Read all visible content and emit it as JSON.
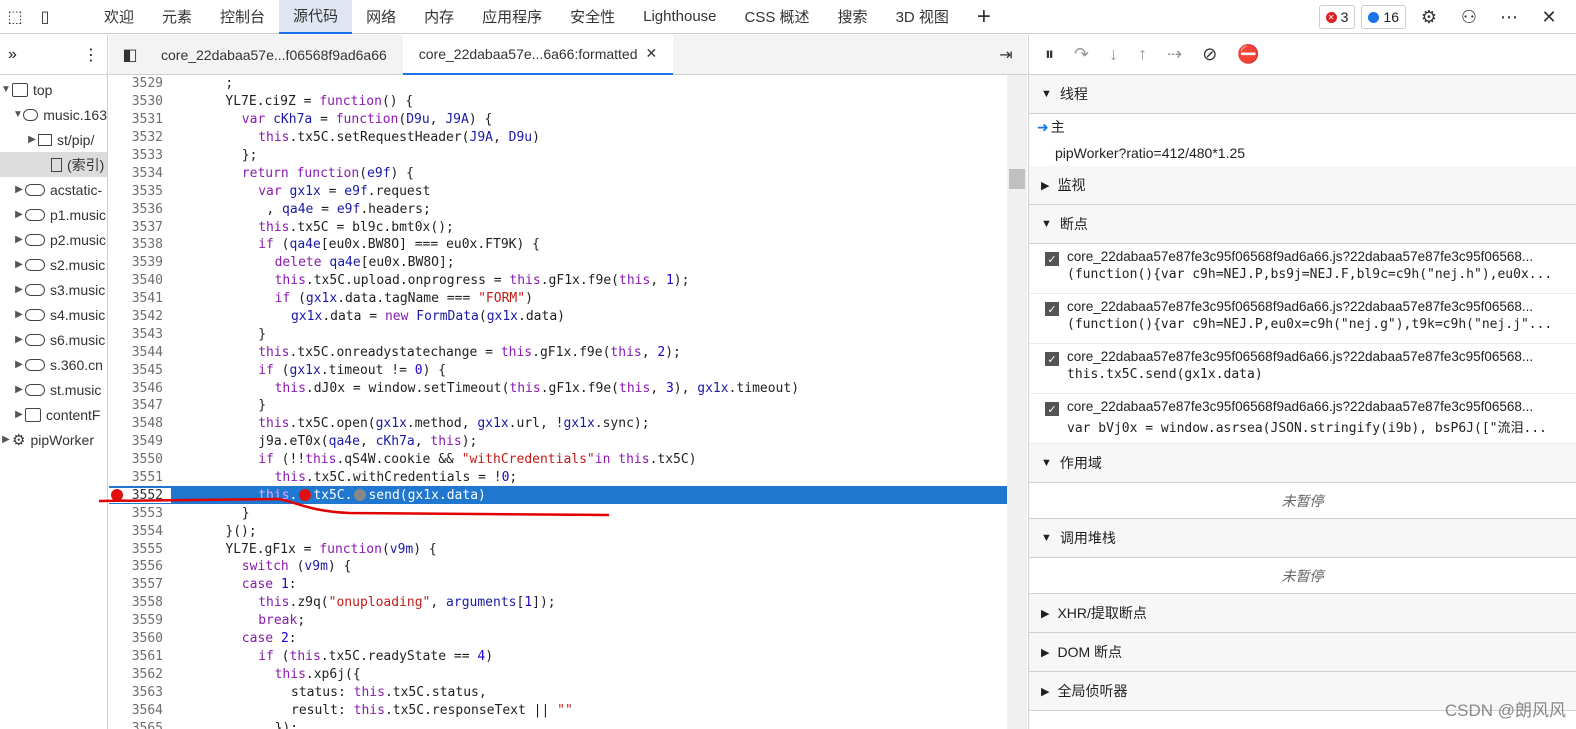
{
  "top_tabs": [
    "欢迎",
    "元素",
    "控制台",
    "源代码",
    "网络",
    "内存",
    "应用程序",
    "安全性",
    "Lighthouse",
    "CSS 概述",
    "搜索",
    "3D 视图"
  ],
  "active_top_tab": 3,
  "error_count": "3",
  "message_count": "16",
  "nav": {
    "items": [
      {
        "label": "top",
        "icon": "frame",
        "indent": 1,
        "arrow": "▼"
      },
      {
        "label": "music.163",
        "icon": "cloud",
        "indent": 2,
        "arrow": "▼"
      },
      {
        "label": "st/pip/",
        "icon": "folder",
        "indent": 3,
        "arrow": "▶"
      },
      {
        "label": "(索引)",
        "icon": "file",
        "indent": 4,
        "arrow": "",
        "selected": true
      },
      {
        "label": "acstatic-",
        "icon": "cloud",
        "indent": 2,
        "arrow": "▶"
      },
      {
        "label": "p1.music",
        "icon": "cloud",
        "indent": 2,
        "arrow": "▶"
      },
      {
        "label": "p2.music",
        "icon": "cloud",
        "indent": 2,
        "arrow": "▶"
      },
      {
        "label": "s2.music",
        "icon": "cloud",
        "indent": 2,
        "arrow": "▶"
      },
      {
        "label": "s3.music",
        "icon": "cloud",
        "indent": 2,
        "arrow": "▶"
      },
      {
        "label": "s4.music",
        "icon": "cloud",
        "indent": 2,
        "arrow": "▶"
      },
      {
        "label": "s6.music",
        "icon": "cloud",
        "indent": 2,
        "arrow": "▶"
      },
      {
        "label": "s.360.cn",
        "icon": "cloud",
        "indent": 2,
        "arrow": "▶"
      },
      {
        "label": "st.music",
        "icon": "cloud",
        "indent": 2,
        "arrow": "▶"
      },
      {
        "label": "contentF",
        "icon": "frame",
        "indent": 2,
        "arrow": "▶"
      },
      {
        "label": "pipWorker",
        "icon": "gear",
        "indent": 1,
        "arrow": "▶"
      }
    ]
  },
  "editor": {
    "tabs": [
      {
        "label": "core_22dabaa57e...f06568f9ad6a66",
        "closable": false
      },
      {
        "label": "core_22dabaa57e...6a66:formatted",
        "closable": true
      }
    ],
    "lines": [
      {
        "n": "3529",
        "indent": 2,
        "html": ";"
      },
      {
        "n": "3530",
        "indent": 2,
        "html": "YL7E.ci9Z = <k>function</k>() {"
      },
      {
        "n": "3531",
        "indent": 4,
        "html": "<k>var</k> <v>cKh7a</v> = <k>function</k>(<v>D9u</v>, <v>J9A</v>) {"
      },
      {
        "n": "3532",
        "indent": 6,
        "html": "<k>this</k>.tx5C.setRequestHeader(<v>J9A</v>, <v>D9u</v>)"
      },
      {
        "n": "3533",
        "indent": 4,
        "html": "};"
      },
      {
        "n": "3534",
        "indent": 4,
        "html": "<k>return</k> <k>function</k>(<v>e9f</v>) {"
      },
      {
        "n": "3535",
        "indent": 6,
        "html": "<k>var</k> <v>gx1x</v> = <v>e9f</v>.request"
      },
      {
        "n": "3536",
        "indent": 7,
        "html": ", <v>qa4e</v> = <v>e9f</v>.headers;"
      },
      {
        "n": "3537",
        "indent": 6,
        "html": "<k>this</k>.tx5C = bl9c.bmt0x();"
      },
      {
        "n": "3538",
        "indent": 6,
        "html": "<k>if</k> (<v>qa4e</v>[eu0x.BW8O] === eu0x.FT9K) {"
      },
      {
        "n": "3539",
        "indent": 8,
        "html": "<k>delete</k> <v>qa4e</v>[eu0x.BW8O];"
      },
      {
        "n": "3540",
        "indent": 8,
        "html": "<k>this</k>.tx5C.upload.onprogress = <k>this</k>.gF1x.f9e(<k>this</k>, <n>1</n>);"
      },
      {
        "n": "3541",
        "indent": 8,
        "html": "<k>if</k> (<v>gx1x</v>.data.tagName === <s>\"FORM\"</s>)"
      },
      {
        "n": "3542",
        "indent": 10,
        "html": "<v>gx1x</v>.data = <k>new</k> <v>FormData</v>(<v>gx1x</v>.data)"
      },
      {
        "n": "3543",
        "indent": 6,
        "html": "}"
      },
      {
        "n": "3544",
        "indent": 6,
        "html": "<k>this</k>.tx5C.onreadystatechange = <k>this</k>.gF1x.f9e(<k>this</k>, <n>2</n>);"
      },
      {
        "n": "3545",
        "indent": 6,
        "html": "<k>if</k> (<v>gx1x</v>.timeout != <n>0</n>) {"
      },
      {
        "n": "3546",
        "indent": 8,
        "html": "<k>this</k>.dJ0x = window.setTimeout(<k>this</k>.gF1x.f9e(<k>this</k>, <n>3</n>), <v>gx1x</v>.timeout)"
      },
      {
        "n": "3547",
        "indent": 6,
        "html": "}"
      },
      {
        "n": "3548",
        "indent": 6,
        "html": "<k>this</k>.tx5C.open(<v>gx1x</v>.method, <v>gx1x</v>.url, !<v>gx1x</v>.sync);"
      },
      {
        "n": "3549",
        "indent": 6,
        "html": "j9a.eT0x(<v>qa4e</v>, <v>cKh7a</v>, <k>this</k>);"
      },
      {
        "n": "3550",
        "indent": 6,
        "html": "<k>if</k> (!!<k>this</k>.qS4W.cookie && <s>\"withCredentials\"</s><k>in</k> <k>this</k>.tx5C)"
      },
      {
        "n": "3551",
        "indent": 8,
        "html": "<k>this</k>.tx5C.withCredentials = !<n>0</n>;"
      },
      {
        "n": "3552",
        "indent": 6,
        "html": "<k>this</k>.<b></b>tx5C.<g></g>send(gx1x.data)",
        "hl": true
      },
      {
        "n": "3553",
        "indent": 4,
        "html": "}"
      },
      {
        "n": "3554",
        "indent": 2,
        "html": "}();"
      },
      {
        "n": "3555",
        "indent": 2,
        "html": "YL7E.gF1x = <k>function</k>(<v>v9m</v>) {"
      },
      {
        "n": "3556",
        "indent": 4,
        "html": "<k>switch</k> (<v>v9m</v>) {"
      },
      {
        "n": "3557",
        "indent": 4,
        "html": "<k>case</k> <n>1</n>:"
      },
      {
        "n": "3558",
        "indent": 6,
        "html": "<k>this</k>.z9q(<s>\"onuploading\"</s>, <v>arguments</v>[<n>1</n>]);"
      },
      {
        "n": "3559",
        "indent": 6,
        "html": "<k>break</k>;"
      },
      {
        "n": "3560",
        "indent": 4,
        "html": "<k>case</k> <n>2</n>:"
      },
      {
        "n": "3561",
        "indent": 6,
        "html": "<k>if</k> (<k>this</k>.tx5C.readyState == <n>4</n>)"
      },
      {
        "n": "3562",
        "indent": 8,
        "html": "<k>this</k>.xp6j({"
      },
      {
        "n": "3563",
        "indent": 10,
        "html": "status: <k>this</k>.tx5C.status,"
      },
      {
        "n": "3564",
        "indent": 10,
        "html": "result: <k>this</k>.tx5C.responseText || <s>\"\"</s>"
      },
      {
        "n": "3565",
        "indent": 8,
        "html": "});"
      }
    ]
  },
  "debugger": {
    "threads_label": "线程",
    "main_thread": "主",
    "worker_thread": "pipWorker?ratio=412/480*1.25",
    "watch_label": "监视",
    "breakpoints_label": "断点",
    "breakpoints": [
      {
        "file": "core_22dabaa57e87fe3c95f06568f9ad6a66.js?22dabaa57e87fe3c95f06568...",
        "code": "(function(){var c9h=NEJ.P,bs9j=NEJ.F,bl9c=c9h(\"nej.h\"),eu0x..."
      },
      {
        "file": "core_22dabaa57e87fe3c95f06568f9ad6a66.js?22dabaa57e87fe3c95f06568...",
        "code": "(function(){var c9h=NEJ.P,eu0x=c9h(\"nej.g\"),t9k=c9h(\"nej.j\"..."
      },
      {
        "file": "core_22dabaa57e87fe3c95f06568f9ad6a66.js?22dabaa57e87fe3c95f06568...",
        "code": "this.tx5C.send(gx1x.data)"
      },
      {
        "file": "core_22dabaa57e87fe3c95f06568f9ad6a66.js?22dabaa57e87fe3c95f06568...",
        "code": "var bVj0x = window.asrsea(JSON.stringify(i9b), bsP6J([\"流泪..."
      }
    ],
    "scope_label": "作用域",
    "scope_status": "未暂停",
    "callstack_label": "调用堆栈",
    "callstack_status": "未暂停",
    "xhr_label": "XHR/提取断点",
    "dom_label": "DOM 断点",
    "listeners_label": "全局侦听器"
  },
  "watermark": "CSDN @朗风风"
}
